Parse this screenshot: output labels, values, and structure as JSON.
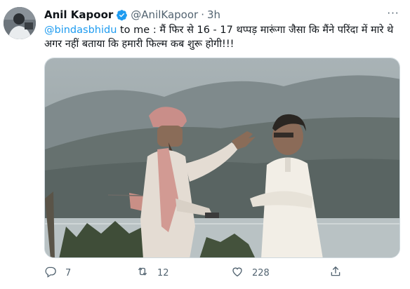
{
  "tweet": {
    "author_name": "Anil Kapoor",
    "author_handle": "@AnilKapoor",
    "separator": "·",
    "timestamp": "3h",
    "more_label": "···",
    "mention": "@bindasbhidu",
    "body_text": " to me : मैं फिर से 16 - 17 थप्पड़ मारूंगा जैसा कि मैंने परिंदा में मारे थे अगर  नहीं बताया कि हमारी फिल्म कब शुरू होगी!!!",
    "media_description": "Two men talking outdoors by a lake with hills in the background"
  },
  "actions": {
    "replies": "7",
    "retweets": "12",
    "likes": "228"
  },
  "colors": {
    "accent": "#1d9bf0",
    "secondary_text": "#536471"
  },
  "icons": {
    "verified": "verified-badge-icon",
    "reply": "reply-icon",
    "retweet": "retweet-icon",
    "like": "heart-icon",
    "share": "share-icon"
  }
}
